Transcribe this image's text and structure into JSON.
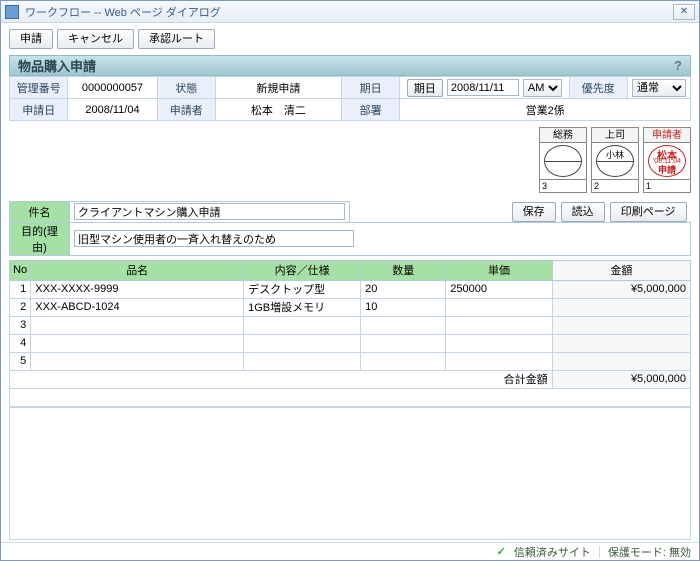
{
  "window_title": "ワークフロー -- Web ページ ダイアログ",
  "toolbar": {
    "apply": "申請",
    "cancel": "キャンセル",
    "route": "承認ルート"
  },
  "page_title": "物品購入申請",
  "info": {
    "mgmt_no_label": "管理番号",
    "mgmt_no": "0000000057",
    "status_label": "状態",
    "status": "新規申請",
    "date_label": "期日",
    "date_btn": "期日",
    "date_value": "2008/11/11",
    "ampm": "AM",
    "priority_label": "優先度",
    "priority": "通常",
    "apply_date_label": "申請日",
    "apply_date": "2008/11/04",
    "applicant_label": "申請者",
    "applicant": "松本　清二",
    "dept_label": "部署",
    "dept": "営業2係"
  },
  "stamps": {
    "h1": "総務",
    "h2": "上司",
    "h3": "申請者",
    "n1": "3",
    "n2": "2",
    "n3": "1",
    "name2": "小林",
    "red_name": "松本",
    "red_date": "'08.11.04",
    "red_word": "申請"
  },
  "subject": {
    "subject_label": "件名",
    "subject_value": "クライアントマシン購入申請",
    "purpose_label": "目的(理由)",
    "purpose_value": "旧型マシン使用者の一斉入れ替えのため",
    "save": "保存",
    "load": "読込",
    "print": "印刷ページ"
  },
  "items": {
    "headers": {
      "no": "No",
      "name": "品名",
      "spec": "内容／仕様",
      "qty": "数量",
      "price": "単価",
      "amount": "金額"
    },
    "rows": [
      {
        "no": "1",
        "name": "XXX-XXXX-9999",
        "spec": "デスクトップ型",
        "qty": "20",
        "price": "250000",
        "amount": "¥5,000,000"
      },
      {
        "no": "2",
        "name": "XXX-ABCD-1024",
        "spec": "1GB増設メモリ",
        "qty": "10",
        "price": "",
        "amount": ""
      },
      {
        "no": "3",
        "name": "",
        "spec": "",
        "qty": "",
        "price": "",
        "amount": ""
      },
      {
        "no": "4",
        "name": "",
        "spec": "",
        "qty": "",
        "price": "",
        "amount": ""
      },
      {
        "no": "5",
        "name": "",
        "spec": "",
        "qty": "",
        "price": "",
        "amount": ""
      }
    ],
    "total_label": "合計金額",
    "total_value": "¥5,000,000"
  },
  "statusbar": {
    "trusted": "信頼済みサイト",
    "protect": "保護モード: 無効"
  }
}
